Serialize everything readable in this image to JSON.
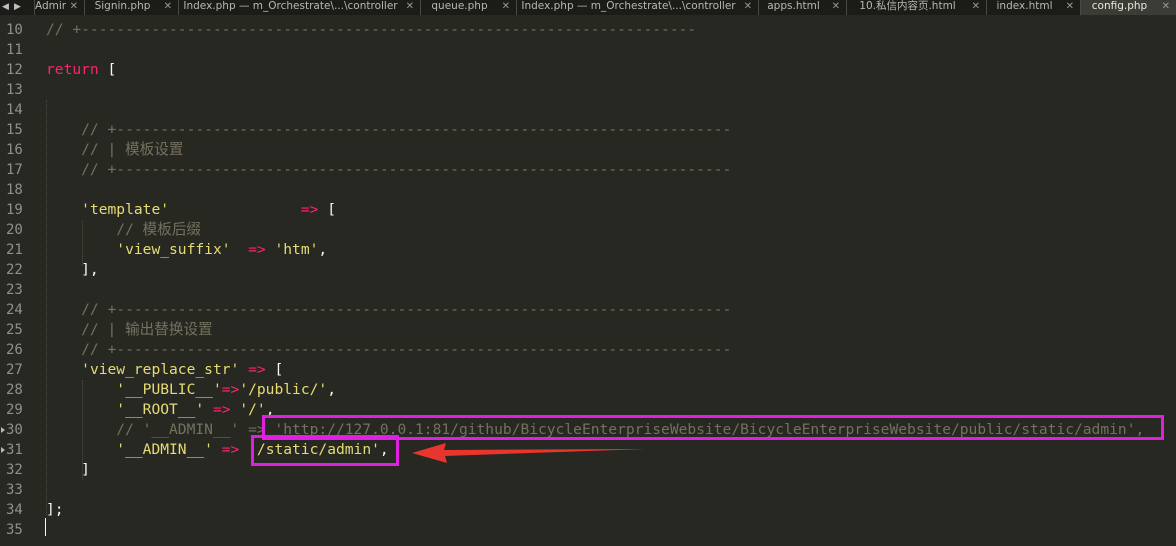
{
  "tabs": [
    {
      "label": "Admin",
      "active": false
    },
    {
      "label": "Signin.php",
      "active": false
    },
    {
      "label": "Index.php — m_Orchestrate\\...\\controller",
      "active": false
    },
    {
      "label": "queue.php",
      "active": false
    },
    {
      "label": "Index.php — m_Orchestrate\\...\\controller",
      "active": false
    },
    {
      "label": "apps.html",
      "active": false
    },
    {
      "label": "10.私信内容页.html",
      "active": false
    },
    {
      "label": "index.html",
      "active": false
    },
    {
      "label": "config.php",
      "active": true
    }
  ],
  "nav": {
    "prev": "◀",
    "next": "▶"
  },
  "close_glyph": "✕",
  "lines": [
    {
      "num": "10",
      "parts": [
        {
          "t": "// +----------------------------------------------------------------------",
          "c": "cm"
        }
      ]
    },
    {
      "num": "11",
      "parts": []
    },
    {
      "num": "12",
      "parts": [
        {
          "t": "return",
          "c": "kw"
        },
        {
          "t": " [",
          "c": ""
        }
      ]
    },
    {
      "num": "13",
      "parts": []
    },
    {
      "num": "14",
      "parts": []
    },
    {
      "num": "15",
      "parts": [
        {
          "t": "    // +----------------------------------------------------------------------",
          "c": "cm"
        }
      ]
    },
    {
      "num": "16",
      "parts": [
        {
          "t": "    // | 模板设置",
          "c": "cm"
        }
      ]
    },
    {
      "num": "17",
      "parts": [
        {
          "t": "    // +----------------------------------------------------------------------",
          "c": "cm"
        }
      ]
    },
    {
      "num": "18",
      "parts": []
    },
    {
      "num": "19",
      "parts": [
        {
          "t": "    ",
          "c": ""
        },
        {
          "t": "'template'",
          "c": "str"
        },
        {
          "t": "               ",
          "c": ""
        },
        {
          "t": "=>",
          "c": "op"
        },
        {
          "t": " [",
          "c": ""
        }
      ]
    },
    {
      "num": "20",
      "parts": [
        {
          "t": "        // 模板后缀",
          "c": "cm"
        }
      ]
    },
    {
      "num": "21",
      "parts": [
        {
          "t": "        ",
          "c": ""
        },
        {
          "t": "'view_suffix'",
          "c": "str"
        },
        {
          "t": "  ",
          "c": ""
        },
        {
          "t": "=>",
          "c": "op"
        },
        {
          "t": " ",
          "c": ""
        },
        {
          "t": "'htm'",
          "c": "str"
        },
        {
          "t": ",",
          "c": ""
        }
      ]
    },
    {
      "num": "22",
      "parts": [
        {
          "t": "    ],",
          "c": ""
        }
      ]
    },
    {
      "num": "23",
      "parts": []
    },
    {
      "num": "24",
      "parts": [
        {
          "t": "    // +----------------------------------------------------------------------",
          "c": "cm"
        }
      ]
    },
    {
      "num": "25",
      "parts": [
        {
          "t": "    // | 输出替换设置",
          "c": "cm"
        }
      ]
    },
    {
      "num": "26",
      "parts": [
        {
          "t": "    // +----------------------------------------------------------------------",
          "c": "cm"
        }
      ]
    },
    {
      "num": "27",
      "parts": [
        {
          "t": "    ",
          "c": ""
        },
        {
          "t": "'view_replace_str'",
          "c": "str"
        },
        {
          "t": " ",
          "c": ""
        },
        {
          "t": "=>",
          "c": "op"
        },
        {
          "t": " [",
          "c": ""
        }
      ]
    },
    {
      "num": "28",
      "parts": [
        {
          "t": "        ",
          "c": ""
        },
        {
          "t": "'__PUBLIC__'",
          "c": "str"
        },
        {
          "t": "=>",
          "c": "op"
        },
        {
          "t": "'/public/'",
          "c": "str"
        },
        {
          "t": ",",
          "c": ""
        }
      ]
    },
    {
      "num": "29",
      "parts": [
        {
          "t": "        ",
          "c": ""
        },
        {
          "t": "'__ROOT__'",
          "c": "str"
        },
        {
          "t": " ",
          "c": ""
        },
        {
          "t": "=>",
          "c": "op"
        },
        {
          "t": " ",
          "c": ""
        },
        {
          "t": "'/'",
          "c": "str"
        },
        {
          "t": ",",
          "c": ""
        }
      ]
    },
    {
      "num": "30",
      "parts": [
        {
          "t": "        // '__ADMIN__' => 'http://127.0.0.1:81/github/BicycleEnterpriseWebsite/BicycleEnterpriseWebsite/public/static/admin',",
          "c": "cm"
        }
      ]
    },
    {
      "num": "31",
      "parts": [
        {
          "t": "        ",
          "c": ""
        },
        {
          "t": "'__ADMIN__'",
          "c": "str"
        },
        {
          "t": " ",
          "c": ""
        },
        {
          "t": "=>",
          "c": "op"
        },
        {
          "t": " ",
          "c": ""
        },
        {
          "t": "'/static/admin'",
          "c": "str"
        },
        {
          "t": ",",
          "c": ""
        }
      ]
    },
    {
      "num": "32",
      "parts": [
        {
          "t": "    ]",
          "c": ""
        }
      ]
    },
    {
      "num": "33",
      "parts": []
    },
    {
      "num": "34",
      "parts": [
        {
          "t": "];",
          "c": ""
        }
      ]
    },
    {
      "num": "35",
      "parts": []
    }
  ],
  "colors": {
    "background": "#272822",
    "comment": "#75715e",
    "keyword": "#f92672",
    "string": "#e6db74",
    "highlight_box": "#e020e0",
    "arrow": "#e8352e"
  }
}
